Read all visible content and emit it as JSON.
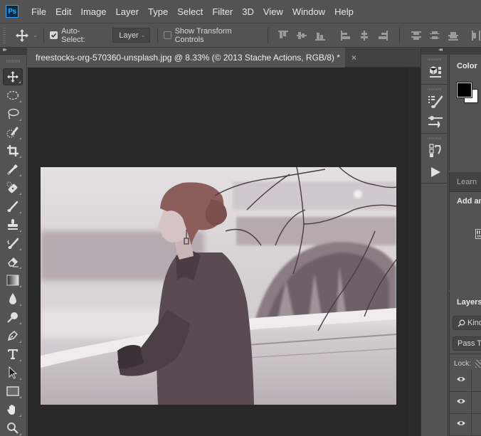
{
  "app": {
    "logo": "Ps",
    "name": "Adobe Photoshop"
  },
  "menu": [
    "File",
    "Edit",
    "Image",
    "Layer",
    "Type",
    "Select",
    "Filter",
    "3D",
    "View",
    "Window",
    "Help"
  ],
  "options_bar": {
    "tool_icon": "move-tool-icon",
    "auto_select_label": "Auto-Select:",
    "auto_select_checked": true,
    "auto_select_target": "Layer",
    "show_transform_label": "Show Transform Controls",
    "show_transform_checked": false,
    "align_icons": [
      "align-top-edges-icon",
      "align-vertical-centers-icon",
      "align-bottom-edges-icon",
      "align-left-edges-icon",
      "align-horizontal-centers-icon",
      "align-right-edges-icon",
      "distribute-top-icon",
      "distribute-vertical-centers-icon",
      "distribute-bottom-icon",
      "distribute-left-icon"
    ]
  },
  "document": {
    "tab_title": "freestocks-org-570360-unsplash.jpg @ 8.33% (© 2013 Stache Actions, RGB/8) *",
    "close_glyph": "×",
    "zoom": "8.33%",
    "filename": "freestocks-org-570360-unsplash.jpg",
    "color_mode": "RGB/8"
  },
  "tools": [
    "move-tool",
    "elliptical-marquee-tool",
    "lasso-tool",
    "quick-selection-tool",
    "crop-tool",
    "eyedropper-tool",
    "spot-healing-brush-tool",
    "brush-tool",
    "clone-stamp-tool",
    "history-brush-tool",
    "eraser-tool",
    "gradient-tool",
    "blur-tool",
    "dodge-tool",
    "pen-tool",
    "type-tool",
    "path-selection-tool",
    "rectangle-tool",
    "hand-tool",
    "zoom-tool"
  ],
  "active_tool": "move-tool",
  "right_dock_icons": [
    "3d-panel-icon",
    "brush-presets-icon",
    "brush-settings-icon",
    "history-icon",
    "actions-play-icon"
  ],
  "panels": {
    "color": {
      "title": "Color",
      "foreground": "#000000",
      "background": "#ffffff"
    },
    "learn": {
      "tab": "Learn",
      "heading": "Add an"
    },
    "layers": {
      "title": "Layers",
      "filter_label": "Kind",
      "blend_mode": "Pass Th",
      "lock_label": "Lock:",
      "rows_visible": 3
    }
  },
  "colors": {
    "chrome": "#535353",
    "canvas_bg": "#282828",
    "accent_ps": "#31a8ff"
  }
}
